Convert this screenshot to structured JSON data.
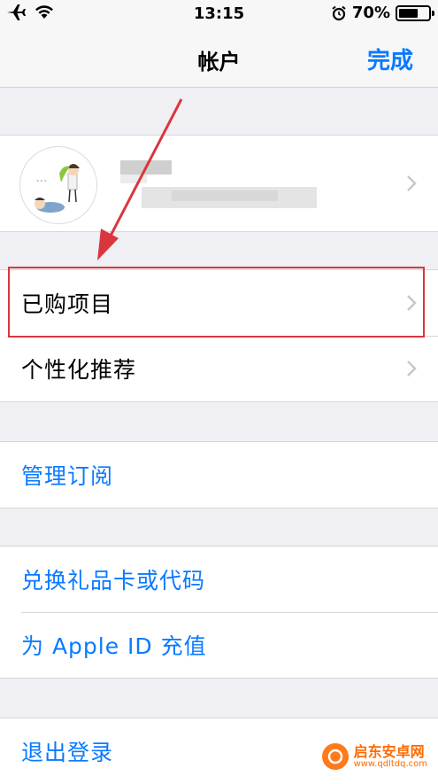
{
  "status_bar": {
    "time": "13:15",
    "battery": "70%",
    "battery_level": 0.7
  },
  "nav": {
    "title": "帐户",
    "done": "完成"
  },
  "menu": {
    "purchased": "已购项目",
    "personalized": "个性化推荐",
    "manage_subscriptions": "管理订阅",
    "redeem": "兑换礼品卡或代码",
    "add_funds": "为 Apple ID 充值",
    "sign_out": "退出登录"
  },
  "watermark": {
    "name": "启东安卓网",
    "url": "www.qdltdq.com"
  },
  "colors": {
    "accent": "#0a7aff",
    "highlight": "#d9363e",
    "background": "#efeff4"
  }
}
